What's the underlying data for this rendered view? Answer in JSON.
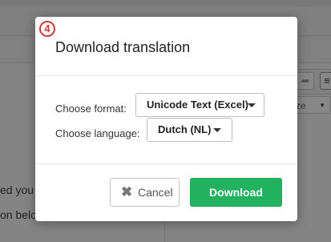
{
  "background": {
    "text_line_1": "ed you",
    "text_line_2": "on belo",
    "toolbar_select_fragment": "ze"
  },
  "modal": {
    "step_badge": "4",
    "title": "Download translation",
    "format": {
      "label": "Choose format:",
      "selected": "Unicode Text (Excel)"
    },
    "language": {
      "label": "Choose language:",
      "selected": "Dutch (NL)"
    },
    "cancel_label": "Cancel",
    "download_label": "Download"
  },
  "colors": {
    "accent_green": "#21b15f",
    "step_badge_red": "#d23b3b",
    "overlay": "rgba(0,0,0,0.47)"
  },
  "icons": {
    "cancel": "close-icon",
    "dropdown": "caret-down-icon"
  }
}
